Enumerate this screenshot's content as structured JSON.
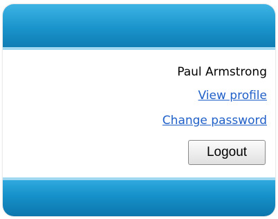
{
  "user": {
    "name": "Paul Armstrong"
  },
  "links": {
    "view_profile": "View profile",
    "change_password": "Change password"
  },
  "buttons": {
    "logout_label": "Logout"
  },
  "colors": {
    "header_blue": "#1a94cc",
    "accent_light_blue": "#9fd8f0",
    "link_blue": "#1f5fc8"
  }
}
